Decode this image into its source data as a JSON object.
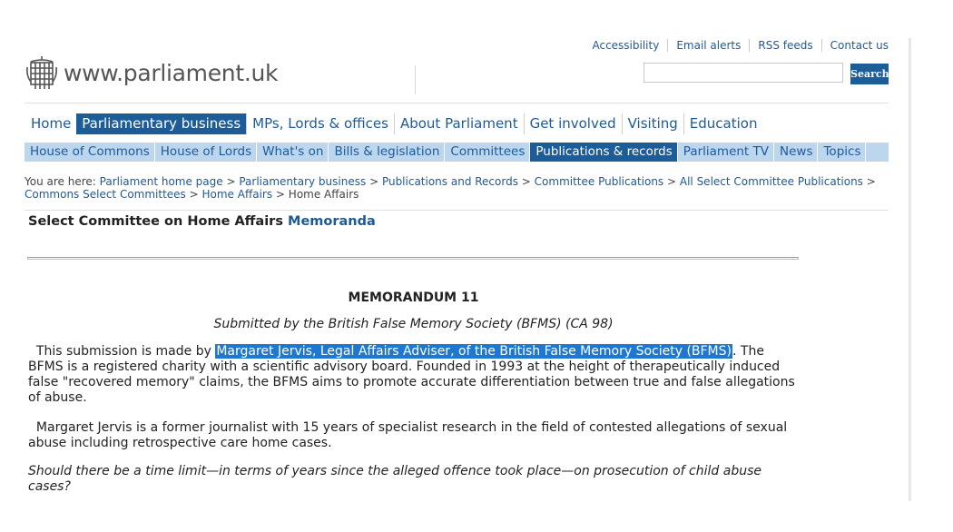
{
  "header": {
    "logo_text": "www.parliament.uk",
    "top_links": [
      "Accessibility",
      "Email alerts",
      "RSS feeds",
      "Contact us"
    ],
    "search": {
      "value": "",
      "button_label": "Search"
    }
  },
  "primary_nav": {
    "items": [
      "Home",
      "Parliamentary business",
      "MPs, Lords & offices",
      "About Parliament",
      "Get involved",
      "Visiting",
      "Education"
    ],
    "active": "Parliamentary business"
  },
  "secondary_nav": {
    "items": [
      "House of Commons",
      "House of Lords",
      "What's on",
      "Bills & legislation",
      "Committees",
      "Publications & records",
      "Parliament TV",
      "News",
      "Topics"
    ],
    "active": "Publications & records"
  },
  "breadcrumb": {
    "prefix": "You are here:",
    "links": [
      "Parliament home page",
      "Parliamentary business",
      "Publications and Records",
      "Committee Publications",
      "All Select Committee Publications",
      "Commons Select Committees",
      "Home Affairs"
    ],
    "current": "Home Affairs"
  },
  "committee": {
    "title": "Select Committee on Home Affairs",
    "section": "Memoranda"
  },
  "content": {
    "heading": "MEMORANDUM 11",
    "submitted_by": "Submitted by the British False Memory Society (BFMS) (CA 98)",
    "para1_lead": "This submission is made by",
    "para1_highlight": "Margaret Jervis, Legal Affairs Adviser, of the British False Memory Society (BFMS)",
    "para1_rest": ". The BFMS is a registered charity with a scientific advisory board. Founded in 1993 at the height of therapeutically induced false \"recovered memory\" claims, the BFMS aims to promote accurate differentiation between true and false allegations of abuse.",
    "para2": "Margaret Jervis is a former journalist with 15 years of specialist research in the field of contested allegations of sexual abuse including retrospective care home cases.",
    "para3": "Should there be a time limit—in terms of years since the alleged offence took place—on prosecution of child abuse cases?"
  },
  "colors": {
    "brand_blue": "#1b5c99",
    "secondary_nav_bg": "#bcd6ee",
    "link": "#1d5a9a",
    "selection_highlight": "#1e78d2"
  }
}
